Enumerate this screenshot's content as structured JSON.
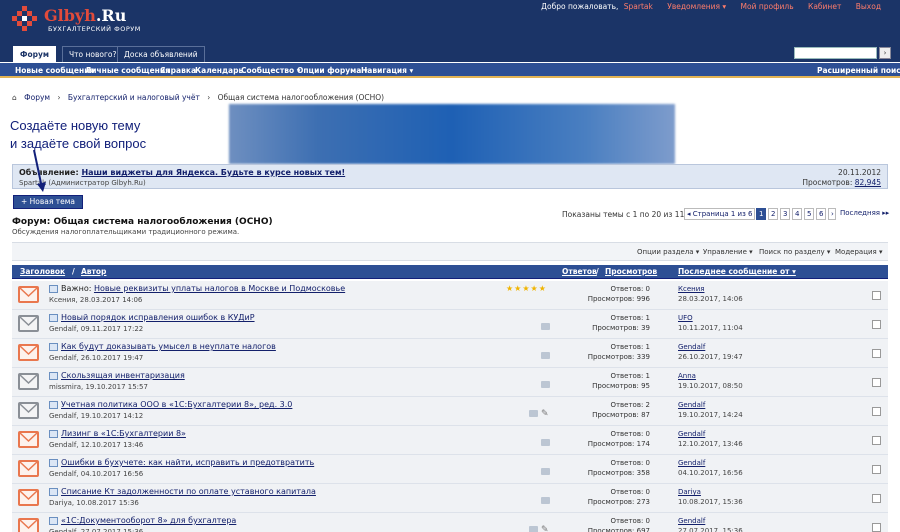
{
  "header": {
    "logo_title_brand": "Glbyh",
    "logo_title_tld": ".Ru",
    "logo_subtitle": "БУХГАЛТЕРСКИЙ ФОРУМ",
    "welcome": "Добро пожаловать,",
    "username": "Spartak",
    "links": [
      "Уведомления ▾",
      "Мой профиль",
      "Кабинет",
      "Выход"
    ]
  },
  "nav": {
    "tabs": [
      "Форум",
      "Что нового?",
      "Доска объявлений"
    ],
    "search_button": "›",
    "subnav": [
      "Новые сообщения",
      "Личные сообщения",
      "Справка",
      "Календарь",
      "Сообщество ▾",
      "Опции форума ▾",
      "Навигация ▾"
    ],
    "advanced_search": "Расширенный поиск"
  },
  "breadcrumb": [
    "Форум",
    "Бухгалтерский и налоговый учёт",
    "Общая система налогообложения (ОСНО)"
  ],
  "annotation": {
    "line1": "Создаёте новую тему",
    "line2": "и задаёте свой вопрос"
  },
  "notice": {
    "label": "Объявление:",
    "title": "Наши виджеты для Яндекса. Будьте в курсе новых тем!",
    "author": "Spartak (Администратор Glbyh.Ru)",
    "date": "20.11.2012",
    "views_label": "Просмотров:",
    "views": "82,945"
  },
  "new_topic_button": "+ Новая тема",
  "forum": {
    "title": "Форум: Общая система налогообложения (ОСНО)",
    "description": "Обсуждения налогоплательщиками традиционного режима."
  },
  "pagination": {
    "info": "Показаны темы с 1 по 20 из 117",
    "prev": "◂ Страница 1 из 6",
    "pages": [
      "1",
      "2",
      "3",
      "4",
      "5",
      "6"
    ],
    "current": "1",
    "next": "›",
    "last": "Последняя ▸▸"
  },
  "toolbar": [
    "Опции раздела ▾",
    "Управление ▾",
    "Поиск по разделу ▾",
    "Модерация ▾"
  ],
  "table_header": {
    "title": "Заголовок",
    "sep1": "/",
    "author": "Автор",
    "replies": "Ответов",
    "sep2": "/",
    "views": "Просмотров",
    "last_post": "Последнее сообщение от ▾"
  },
  "threads": [
    {
      "prefix": "Важно:",
      "title": "Новые реквизиты уплаты налогов в Москве и Подмосковье",
      "author_date": "Ксения, 28.03.2017 14:06",
      "replies": "Ответов: 0",
      "views": "Просмотров: 996",
      "last_user": "Ксения",
      "last_date": "28.03.2017, 14:06",
      "stars": "★★★★★",
      "hot": true
    },
    {
      "prefix": "",
      "title": "Новый порядок исправления ошибок в КУДиР",
      "author_date": "Gendalf, 09.11.2017 17:22",
      "replies": "Ответов: 1",
      "views": "Просмотров: 39",
      "last_user": "UFO",
      "last_date": "10.11.2017, 11:04",
      "hot": false
    },
    {
      "prefix": "",
      "title": "Как будут доказывать умысел в неуплате налогов",
      "author_date": "Gendalf, 26.10.2017 19:47",
      "replies": "Ответов: 1",
      "views": "Просмотров: 339",
      "last_user": "Gendalf",
      "last_date": "26.10.2017, 19:47",
      "hot": true
    },
    {
      "prefix": "",
      "title": "Скользящая инвентаризация",
      "author_date": "missmira, 19.10.2017 15:57",
      "replies": "Ответов: 1",
      "views": "Просмотров: 95",
      "last_user": "Anna",
      "last_date": "19.10.2017, 08:50",
      "hot": false
    },
    {
      "prefix": "",
      "title": "Учетная политика ООО в «1С:Бухгалтерии 8», ред. 3.0",
      "author_date": "Gendalf, 19.10.2017 14:12",
      "replies": "Ответов: 2",
      "views": "Просмотров: 87",
      "last_user": "Gendalf",
      "last_date": "19.10.2017, 14:24",
      "hot": false
    },
    {
      "prefix": "",
      "title": "Лизинг в «1С:Бухгалтерии 8»",
      "author_date": "Gendalf, 12.10.2017 13:46",
      "replies": "Ответов: 0",
      "views": "Просмотров: 174",
      "last_user": "Gendalf",
      "last_date": "12.10.2017, 13:46",
      "hot": true
    },
    {
      "prefix": "",
      "title": "Ошибки в бухучете: как найти, исправить и предотвратить",
      "author_date": "Gendalf, 04.10.2017 16:56",
      "replies": "Ответов: 0",
      "views": "Просмотров: 358",
      "last_user": "Gendalf",
      "last_date": "04.10.2017, 16:56",
      "hot": true
    },
    {
      "prefix": "",
      "title": "Списание Кт задолженности по оплате уставного капитала",
      "author_date": "Dariya, 10.08.2017 15:36",
      "replies": "Ответов: 0",
      "views": "Просмотров: 273",
      "last_user": "Dariya",
      "last_date": "10.08.2017, 15:36",
      "hot": true
    },
    {
      "prefix": "",
      "title": "«1С:Документооборот 8» для бухгалтера",
      "author_date": "Gendalf, 27.07.2017 15:36",
      "replies": "Ответов: 0",
      "views": "Просмотров: 697",
      "last_user": "Gendalf",
      "last_date": "27.07.2017, 15:36",
      "hot": true
    }
  ],
  "colors": {
    "header_bg": "#1b3467",
    "subnav_bg": "#2d4f94",
    "accent_red": "#e14b3b",
    "envelope_hot": "#e9774e",
    "envelope_cold": "#8a8f96"
  }
}
